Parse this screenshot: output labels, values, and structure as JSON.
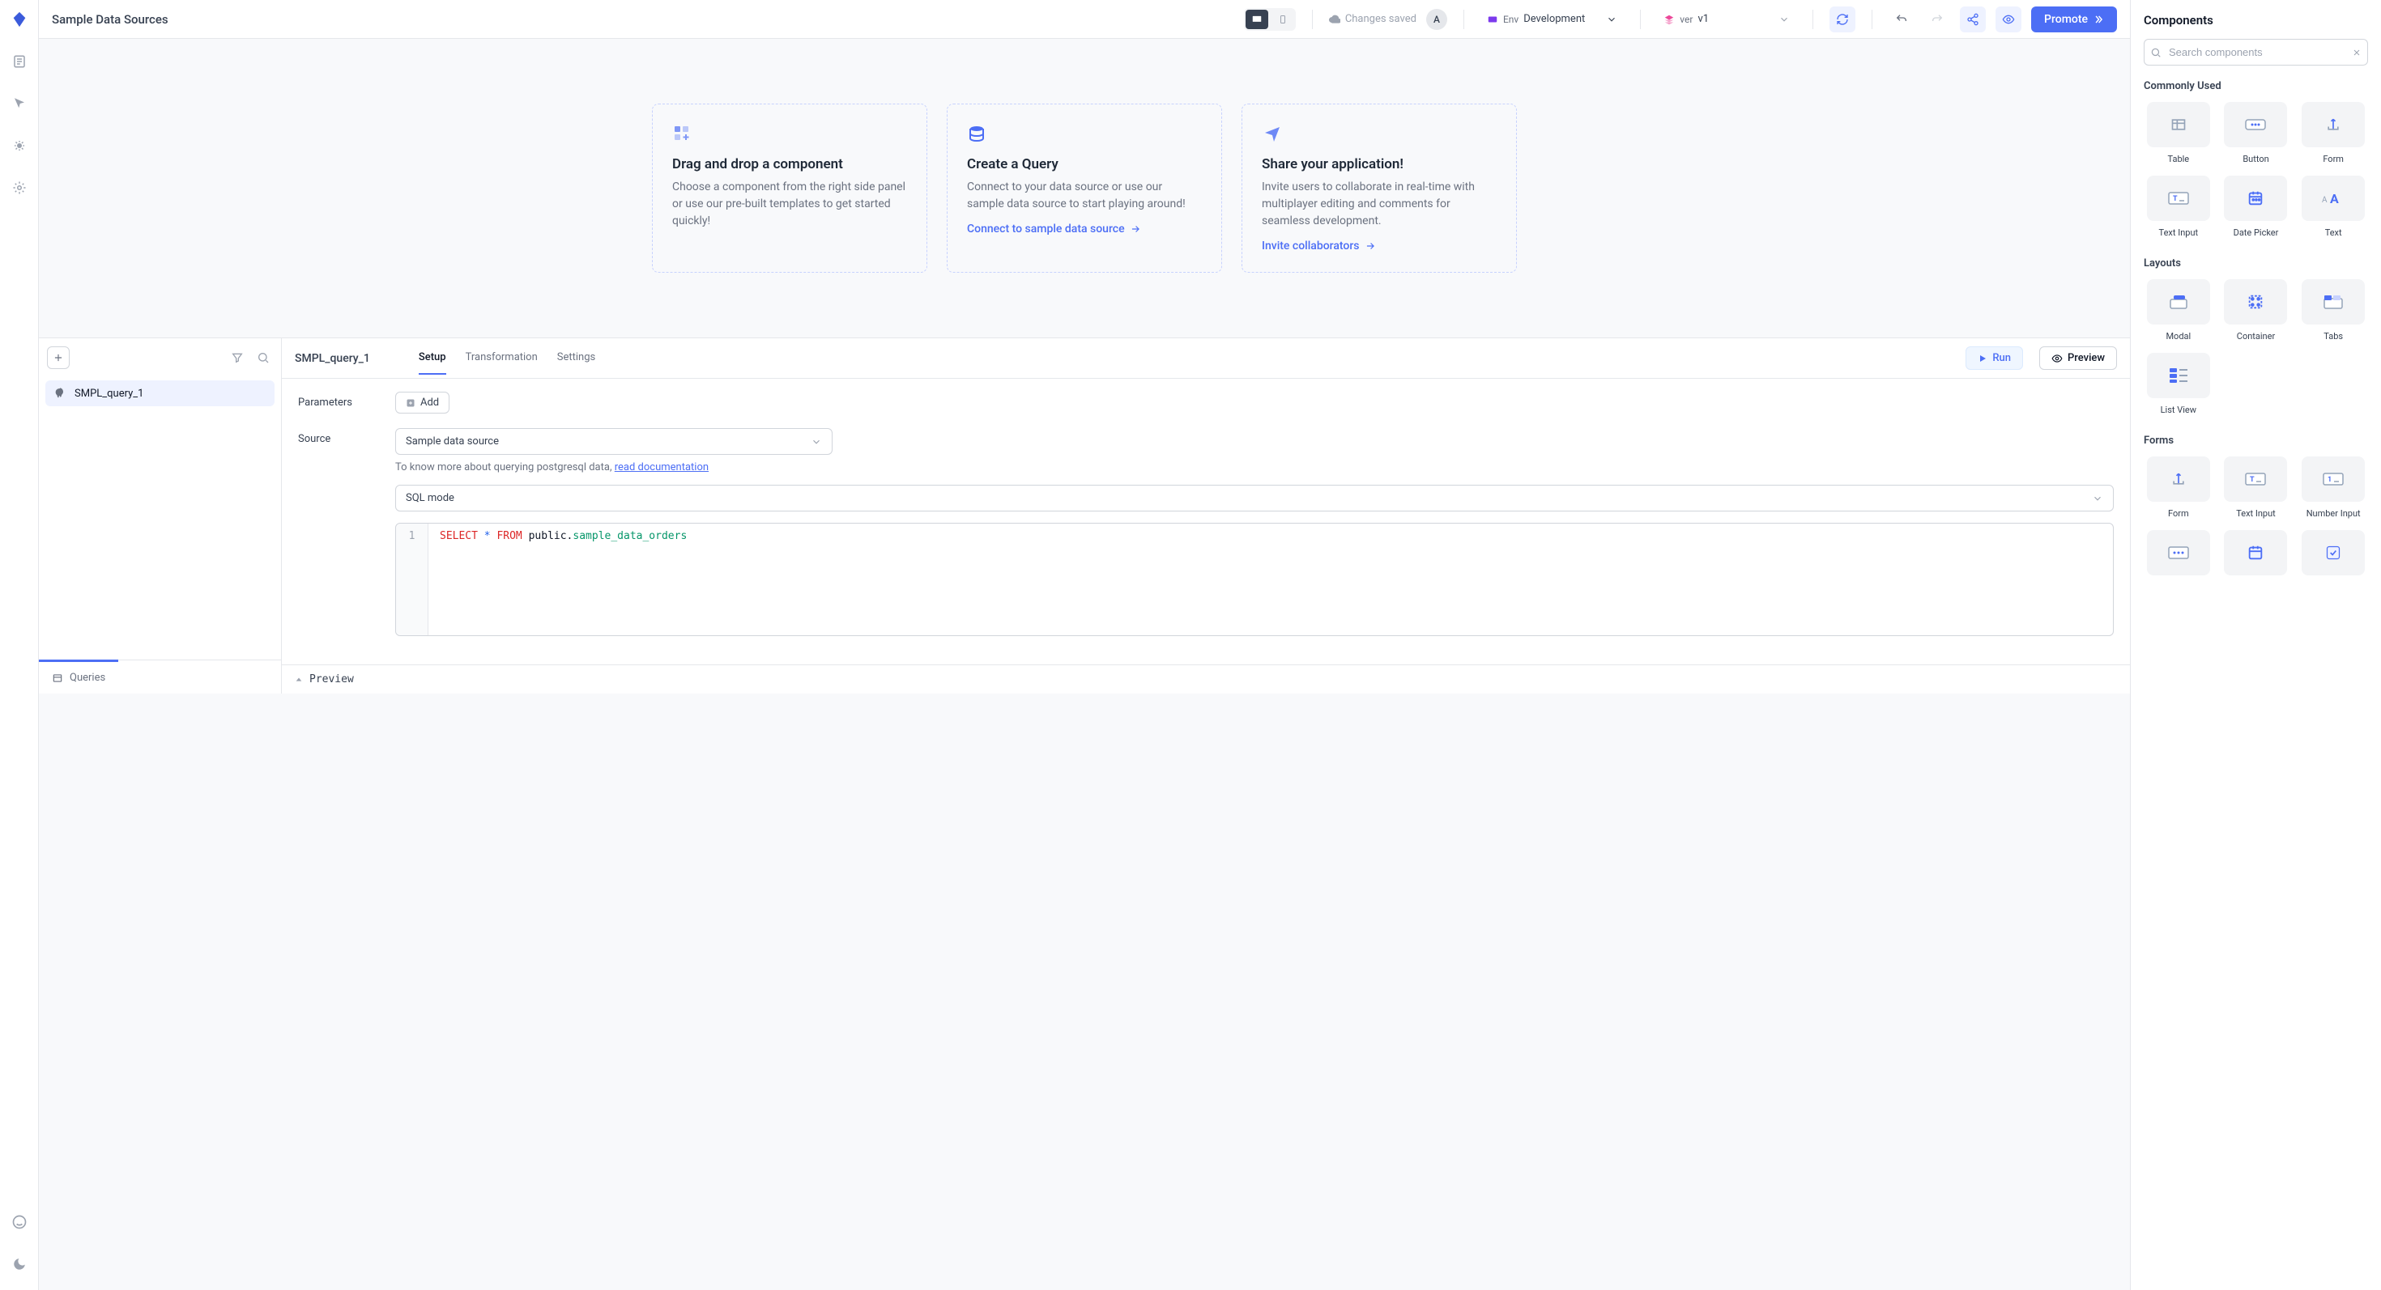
{
  "header": {
    "app_title": "Sample Data Sources",
    "save_status": "Changes saved",
    "avatar_initial": "A",
    "env_label": "Env",
    "env_value": "Development",
    "ver_label": "ver",
    "ver_value": "v1",
    "promote_label": "Promote"
  },
  "onboard": {
    "card1": {
      "title": "Drag and drop a component",
      "desc": "Choose a component from the right side panel or use our pre-built templates to get started quickly!"
    },
    "card2": {
      "title": "Create a Query",
      "desc": "Connect to your data source or use our sample data source to start playing around!",
      "link": "Connect to sample data source"
    },
    "card3": {
      "title": "Share your application!",
      "desc": "Invite users to collaborate in real-time with multiplayer editing and comments for seamless development.",
      "link": "Invite collaborators"
    }
  },
  "queries": {
    "tab_label": "Queries",
    "items": [
      {
        "name": "SMPL_query_1"
      }
    ],
    "editor": {
      "name": "SMPL_query_1",
      "tabs": {
        "setup": "Setup",
        "transformation": "Transformation",
        "settings": "Settings"
      },
      "run_label": "Run",
      "preview_label": "Preview",
      "params_label": "Parameters",
      "add_label": "Add",
      "source_label": "Source",
      "source_value": "Sample data source",
      "help_prefix": "To know more about querying postgresql data, ",
      "help_link": "read documentation",
      "mode_value": "SQL mode",
      "sql": {
        "line_no": "1",
        "select": "SELECT",
        "star": "*",
        "from": "FROM",
        "schema": "public.",
        "table": "sample_data_orders"
      },
      "footer_label": "Preview"
    }
  },
  "components": {
    "title": "Components",
    "search_placeholder": "Search components",
    "sections": {
      "common": "Commonly Used",
      "layouts": "Layouts",
      "forms": "Forms"
    },
    "common_items": [
      "Table",
      "Button",
      "Form",
      "Text Input",
      "Date Picker",
      "Text"
    ],
    "layout_items": [
      "Modal",
      "Container",
      "Tabs",
      "List View"
    ],
    "form_items": [
      "Form",
      "Text Input",
      "Number Input"
    ]
  }
}
